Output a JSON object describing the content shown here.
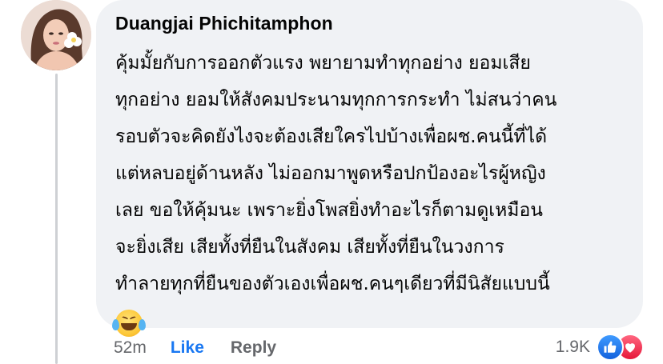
{
  "comment": {
    "author": "Duangjai Phichitamphon",
    "lines": [
      "คุ้มมั้ยกับการออกตัวแรง พยายามทำทุกอย่าง ยอมเสีย",
      "ทุกอย่าง ยอมให้สังคมประนามทุกการกระทำ ไม่สนว่าคน",
      "รอบตัวจะคิดยังไงจะต้องเสียใครไปบ้างเพื่อผช.คนนี้ที่ได้",
      "แต่หลบอยู่ด้านหลัง ไม่ออกมาพูดหรือปกป้องอะไรผู้หญิง",
      "เลย ขอให้คุ้มนะ เพราะยิ่งโพสยิ่งทำอะไรก็ตามดูเหมือน",
      "จะยิ่งเสีย เสียทั้งที่ยืนในสังคม เสียทั้งที่ยืนในวงการ",
      "ทำลายทุกที่ยืนของตัวเองเพื่อผช.คนๆเดียวที่มีนิสัยแบบนี้"
    ],
    "emoji": "face-with-tears-of-joy-icon"
  },
  "actions": {
    "time": "52m",
    "like_label": "Like",
    "reply_label": "Reply"
  },
  "reactions": {
    "count": "1.9K",
    "icons": [
      "like-reaction-icon",
      "love-reaction-icon"
    ]
  },
  "colors": {
    "bubble": "#f0f2f5",
    "like_blue": "#1877f2",
    "meta_gray": "#65676b",
    "love_red": "#f33e58"
  }
}
